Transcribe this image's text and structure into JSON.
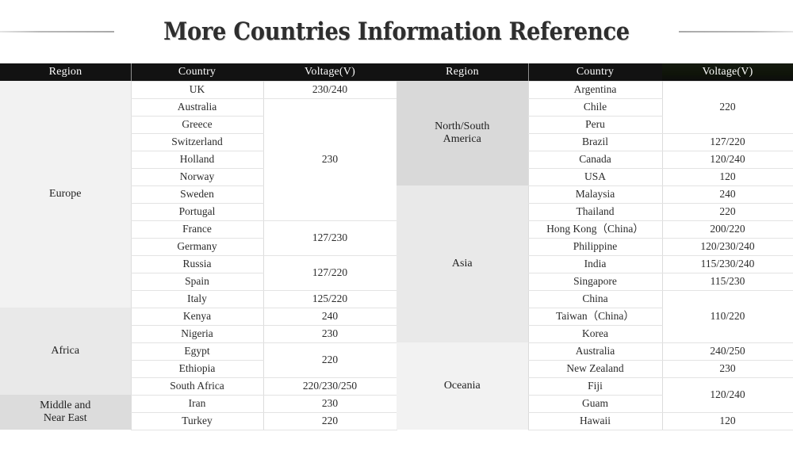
{
  "title": "More Countries Information Reference",
  "columns": {
    "region": "Region",
    "country": "Country",
    "voltage": "Voltage(V)"
  },
  "accent": {
    "header_bg": "#121212",
    "header_text": "#ffffff",
    "title_color": "#2e2e2e",
    "rule_color": "#b9b9b9",
    "green_tint": "#151a10"
  },
  "left_table": {
    "regions": [
      {
        "name": "Europe",
        "shade": "shade-a",
        "rows": [
          {
            "country": "UK",
            "voltage": "230/240",
            "span": 1
          },
          {
            "country": "Australia",
            "voltage": "230",
            "span": 7
          },
          {
            "country": "Greece"
          },
          {
            "country": "Switzerland"
          },
          {
            "country": "Holland"
          },
          {
            "country": "Norway"
          },
          {
            "country": "Sweden"
          },
          {
            "country": "Portugal"
          },
          {
            "country": "France",
            "voltage": "127/230",
            "span": 2
          },
          {
            "country": "Germany"
          },
          {
            "country": "Russia",
            "voltage": "127/220",
            "span": 2
          },
          {
            "country": "Spain"
          },
          {
            "country": "Italy",
            "voltage": "125/220",
            "span": 1
          }
        ]
      },
      {
        "name": "Africa",
        "shade": "shade-b",
        "rows": [
          {
            "country": "Kenya",
            "voltage": "240",
            "span": 1
          },
          {
            "country": "Nigeria",
            "voltage": "230",
            "span": 1
          },
          {
            "country": "Egypt",
            "voltage": "220",
            "span": 2
          },
          {
            "country": "Ethiopia"
          },
          {
            "country": "South Africa",
            "voltage": "220/230/250",
            "span": 1
          }
        ]
      },
      {
        "name": "Middle and\nNear East",
        "name_line1": "Middle and",
        "name_line2": "Near East",
        "shade": "shade-d",
        "rows": [
          {
            "country": "Iran",
            "voltage": "230",
            "span": 1
          },
          {
            "country": "Turkey",
            "voltage": "220",
            "span": 1
          }
        ]
      }
    ]
  },
  "right_table": {
    "regions": [
      {
        "name": "North/South\nAmerica",
        "name_line1": "North/South",
        "name_line2": "America",
        "shade": "shade-c",
        "rows": [
          {
            "country": "Argentina",
            "voltage": "220",
            "span": 3
          },
          {
            "country": "Chile"
          },
          {
            "country": "Peru"
          },
          {
            "country": "Brazil",
            "voltage": "127/220",
            "span": 1
          },
          {
            "country": "Canada",
            "voltage": "120/240",
            "span": 1
          },
          {
            "country": "USA",
            "voltage": "120",
            "span": 1
          }
        ]
      },
      {
        "name": "Asia",
        "shade": "shade-b",
        "rows": [
          {
            "country": "Malaysia",
            "voltage": "240",
            "span": 1
          },
          {
            "country": "Thailand",
            "voltage": "220",
            "span": 1
          },
          {
            "country": "Hong Kong（China）",
            "voltage": "200/220",
            "span": 1
          },
          {
            "country": "Philippine",
            "voltage": "120/230/240",
            "span": 1
          },
          {
            "country": "India",
            "voltage": "115/230/240",
            "span": 1
          },
          {
            "country": "Singapore",
            "voltage": "115/230",
            "span": 1
          },
          {
            "country": "China",
            "voltage": "110/220",
            "span": 3
          },
          {
            "country": "Taiwan（China）"
          },
          {
            "country": "Korea"
          }
        ]
      },
      {
        "name": "Oceania",
        "shade": "shade-a",
        "rows": [
          {
            "country": "Australia",
            "voltage": "240/250",
            "span": 1
          },
          {
            "country": "New Zealand",
            "voltage": "230",
            "span": 1
          },
          {
            "country": "Fiji",
            "voltage": "120/240",
            "span": 2
          },
          {
            "country": "Guam"
          },
          {
            "country": "Hawaii",
            "voltage": "120",
            "span": 1
          }
        ]
      }
    ]
  }
}
